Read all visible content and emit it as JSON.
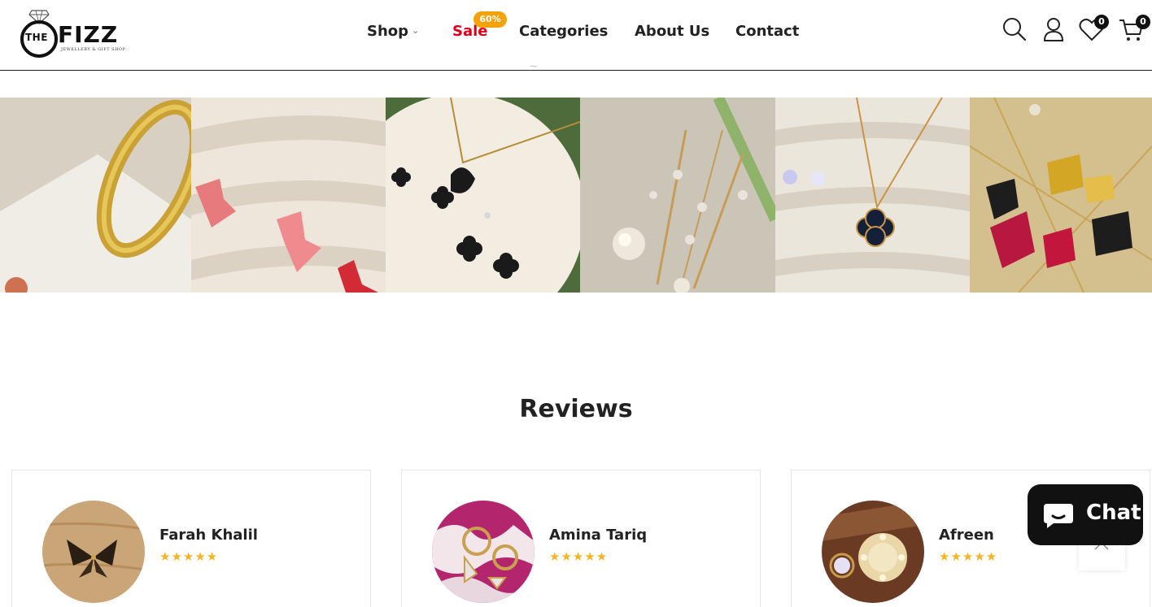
{
  "logo": {
    "the": "THE",
    "name": "FIZZ",
    "tagline": "JEWELLERY & GIFT SHOP"
  },
  "nav": {
    "shop": "Shop",
    "sale": "Sale",
    "sale_badge": "60%",
    "categories": "Categories",
    "about": "About Us",
    "contact": "Contact"
  },
  "header_icons": {
    "search": "search-icon",
    "account": "user-icon",
    "wishlist": "heart-icon",
    "wishlist_count": "0",
    "cart": "cart-icon",
    "cart_count": "0"
  },
  "gallery": {
    "items": [
      {
        "name": "gold-bangle-image"
      },
      {
        "name": "pink-butterfly-studs-image"
      },
      {
        "name": "swan-clover-set-image"
      },
      {
        "name": "pearl-drop-earrings-image"
      },
      {
        "name": "blue-clover-necklace-image"
      },
      {
        "name": "butterfly-necklaces-image"
      }
    ]
  },
  "reviews": {
    "title": "Reviews",
    "items": [
      {
        "name": "Farah Khalil",
        "stars": "★★★★★",
        "rating": 5
      },
      {
        "name": "Amina Tariq",
        "stars": "★★★★★",
        "rating": 5
      },
      {
        "name": "Afreen",
        "stars": "★★★★★",
        "rating": 5
      }
    ]
  },
  "chat": {
    "label": "Chat"
  },
  "colors": {
    "sale": "#e0001b",
    "badge": "#f5a20a",
    "stars": "#f5b423",
    "dark": "#111111"
  }
}
